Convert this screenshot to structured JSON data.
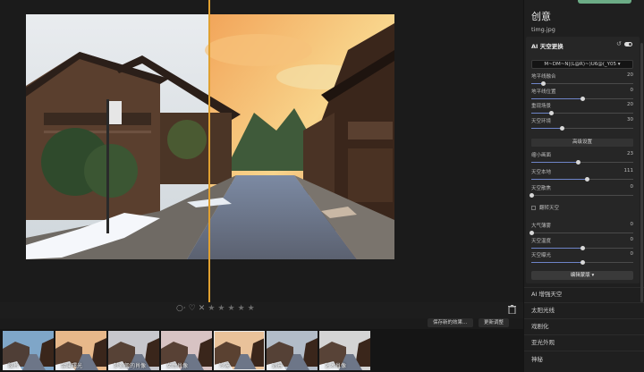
{
  "panel": {
    "title": "创意",
    "file_name": "timg.jpg",
    "section_title": "AI 天空更换",
    "undo_icon": "undo-icon",
    "sky_select": "M~DM~N|(L@R)~)U6@(_Y05 ▾",
    "sliders": [
      {
        "label": "地平线融合",
        "value": "20",
        "percent": 0.12
      },
      {
        "label": "地平线位置",
        "value": "0",
        "percent": 0.5
      },
      {
        "label": "重现场景",
        "value": "20",
        "percent": 0.2
      },
      {
        "label": "天空环境",
        "value": "30",
        "percent": 0.3
      }
    ],
    "advanced_label": "高级设置",
    "advanced_sliders": [
      {
        "label": "缩小画面",
        "value": "23",
        "percent": 0.46
      },
      {
        "label": "天空本地",
        "value": "111",
        "percent": 0.55
      },
      {
        "label": "天空散焦",
        "value": "0",
        "percent": 0.0
      }
    ],
    "flip_sky_label": "翻转天空",
    "lower_sliders": [
      {
        "label": "大气薄雾",
        "value": "0",
        "percent": 0.0
      },
      {
        "label": "天空温度",
        "value": "0",
        "percent": 0.5
      },
      {
        "label": "天空曝光",
        "value": "0",
        "percent": 0.5
      }
    ],
    "edit_mask_label": "编辑蒙版 ▾",
    "items": [
      "AI 增强天空",
      "太阳光线",
      "戏剧化",
      "亚光外观",
      "神秘"
    ]
  },
  "rating": {
    "label": "○·",
    "heart": "♡",
    "reject": "✕",
    "stars": [
      "★",
      "★",
      "★",
      "★",
      "★"
    ]
  },
  "strip_tools": {
    "save_preset": "保存新的效果…",
    "update_preset": "更新调整"
  },
  "thumbnails": [
    {
      "label": "胶片",
      "tint": "#7fa6c8"
    },
    {
      "label": "金属曙光",
      "tint": "#e7b88a"
    },
    {
      "label": "梦幻般的肖像",
      "tint": "#c7c7cc"
    },
    {
      "label": "女性肖像",
      "tint": "#d8c3c3"
    },
    {
      "label": "冷漠",
      "tint": "#e9c29a"
    },
    {
      "label": "远景",
      "tint": "#b2bcc8"
    },
    {
      "label": "艺术肖像",
      "tint": "#d4d4d4"
    }
  ],
  "colors": {
    "accent": "#e0a030",
    "slider_fill": "#6e84c8",
    "background": "#1b1b1b"
  }
}
